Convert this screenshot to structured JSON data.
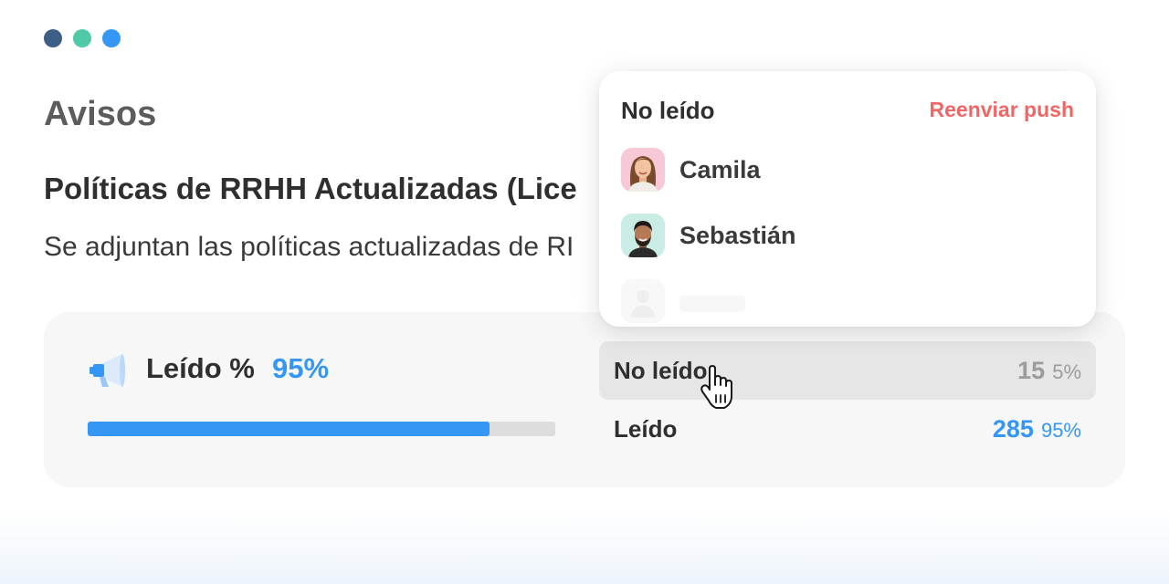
{
  "window": {
    "dot_colors": [
      "#3d5f86",
      "#4fcaa9",
      "#3597f4"
    ]
  },
  "page": {
    "title": "Avisos"
  },
  "notice": {
    "title": "Políticas de RRHH Actualizadas (Lice",
    "body": "Se adjuntan las políticas actualizadas de RI"
  },
  "stats": {
    "read_label": "Leído %",
    "read_percent_text": "95%",
    "read_progress": 0.86,
    "rows": [
      {
        "label": "No leído",
        "count": "15",
        "percent": "5%",
        "color": "#9c9c9c"
      },
      {
        "label": "Leído",
        "count": "285",
        "percent": "95%",
        "color": "#3597f4"
      }
    ]
  },
  "popover": {
    "title": "No leído",
    "action_label": "Reenviar push",
    "users": [
      {
        "name": "Camila",
        "avatar_bg": "#f7c9d7"
      },
      {
        "name": "Sebastián",
        "avatar_bg": "#c9ece4"
      }
    ]
  },
  "icons": {
    "megaphone": "megaphone-icon",
    "cursor": "hand-pointer-icon",
    "placeholder_avatar": "user-placeholder-icon"
  },
  "colors": {
    "accent": "#3597f4",
    "danger": "#f26565",
    "muted": "#9c9c9c"
  }
}
